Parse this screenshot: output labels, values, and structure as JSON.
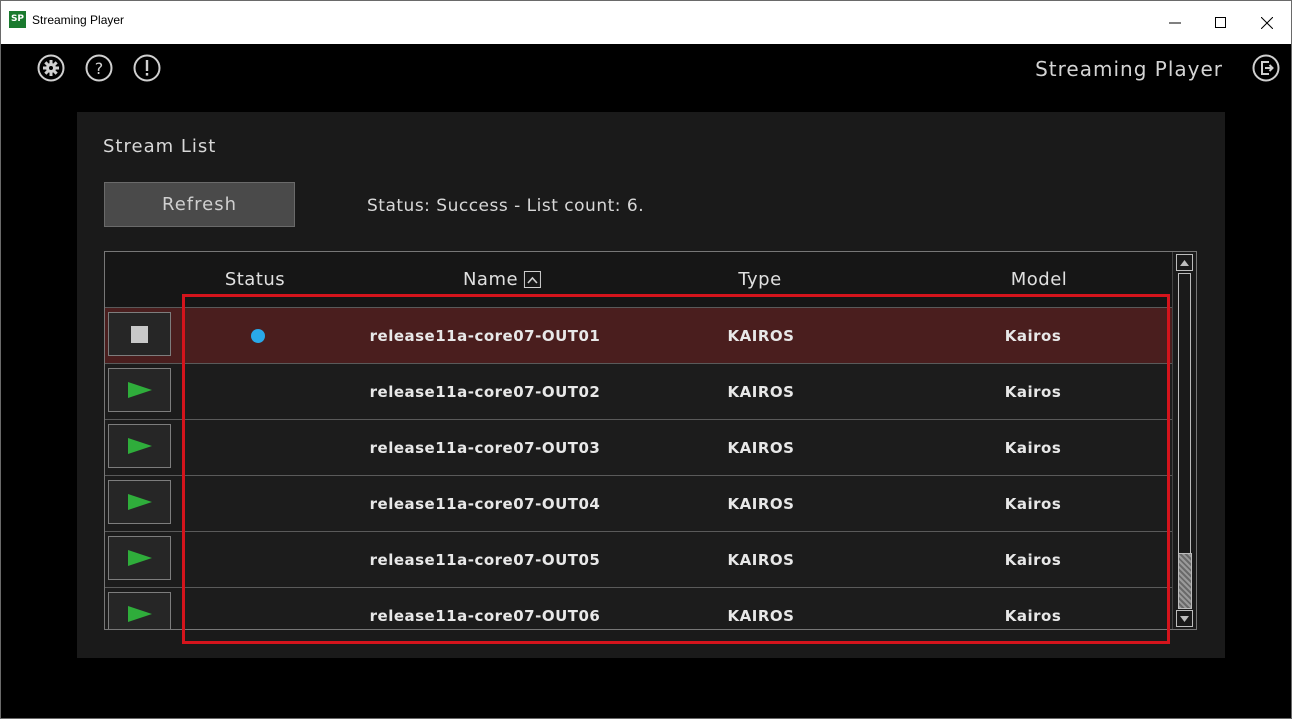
{
  "window": {
    "title": "Streaming Player",
    "app_icon_text": "SP"
  },
  "header": {
    "app_name": "Streaming Player",
    "icons": [
      "gear-icon",
      "help-icon",
      "alert-icon",
      "logout-icon"
    ]
  },
  "stream_list": {
    "title": "Stream List",
    "refresh_label": "Refresh",
    "status_text": "Status: Success - List count: 6.",
    "columns": {
      "status": "Status",
      "name": "Name",
      "type": "Type",
      "model": "Model"
    },
    "rows": [
      {
        "name": "release11a-core07-OUT01",
        "type": "KAIROS",
        "model": "Kairos",
        "playing": true,
        "selected": true
      },
      {
        "name": "release11a-core07-OUT02",
        "type": "KAIROS",
        "model": "Kairos",
        "playing": false,
        "selected": false
      },
      {
        "name": "release11a-core07-OUT03",
        "type": "KAIROS",
        "model": "Kairos",
        "playing": false,
        "selected": false
      },
      {
        "name": "release11a-core07-OUT04",
        "type": "KAIROS",
        "model": "Kairos",
        "playing": false,
        "selected": false
      },
      {
        "name": "release11a-core07-OUT05",
        "type": "KAIROS",
        "model": "Kairos",
        "playing": false,
        "selected": false
      },
      {
        "name": "release11a-core07-OUT06",
        "type": "KAIROS",
        "model": "Kairos",
        "playing": false,
        "selected": false
      }
    ]
  },
  "colors": {
    "status_dot": "#29a8e8",
    "play_icon": "#2fad3b",
    "selected_row": "#4a1e1e",
    "highlight": "#d4141c"
  }
}
